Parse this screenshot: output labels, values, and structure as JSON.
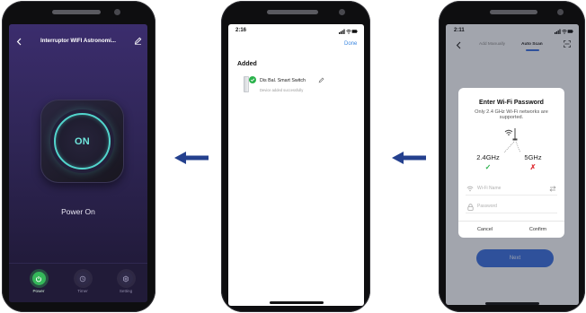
{
  "flow": {
    "arrow_icon": "arrow-left-icon"
  },
  "phone1": {
    "header": {
      "back_icon": "chevron-left-icon",
      "title": "Interruptor WIFI Astronomi...",
      "edit_icon": "pencil-icon"
    },
    "power_button": {
      "label": "ON",
      "is_on": true
    },
    "status_text": "Power On",
    "tabs": [
      {
        "label": "Power",
        "icon": "power-icon",
        "active": true
      },
      {
        "label": "Timer",
        "icon": "timer-icon",
        "active": false
      },
      {
        "label": "Setting",
        "icon": "gear-icon",
        "active": false
      }
    ]
  },
  "phone2": {
    "status_bar": {
      "time": "2:16",
      "icons": [
        "signal-icon",
        "wifi-icon",
        "battery-icon"
      ]
    },
    "done_label": "Done",
    "section_title": "Added",
    "device": {
      "name": "Dis Bal. Smart Switch",
      "status": "Device added successfully",
      "edit_icon": "pencil-icon"
    }
  },
  "phone3": {
    "status_bar": {
      "time": "2:11",
      "icons": [
        "signal-icon",
        "wifi-icon",
        "battery-icon"
      ]
    },
    "header": {
      "back_icon": "chevron-left-icon",
      "tabs": [
        {
          "label": "Add Manually",
          "active": false
        },
        {
          "label": "Auto Scan",
          "active": true
        }
      ],
      "scan_icon": "scan-icon"
    },
    "dialog": {
      "title": "Enter Wi-Fi Password",
      "subtitle": "Only 2.4 GHz Wi-Fi networks are supported.",
      "router_icon": "router-icon",
      "bands": [
        {
          "label": "2.4GHz",
          "supported": true,
          "mark": "✓"
        },
        {
          "label": "5GHz",
          "supported": false,
          "mark": "✗"
        }
      ],
      "wifi_name_placeholder": "Wi-Fi Name",
      "password_placeholder": "Password",
      "cancel_label": "Cancel",
      "confirm_label": "Confirm"
    },
    "next_label": "Next"
  },
  "colors": {
    "arrow": "#24408e",
    "cyan": "#52d5cd",
    "power_green": "#35b85a",
    "link_blue": "#3a86e0",
    "next_blue": "#3a6fdb",
    "check_green": "#2bb24c",
    "cross_red": "#e0343a"
  }
}
